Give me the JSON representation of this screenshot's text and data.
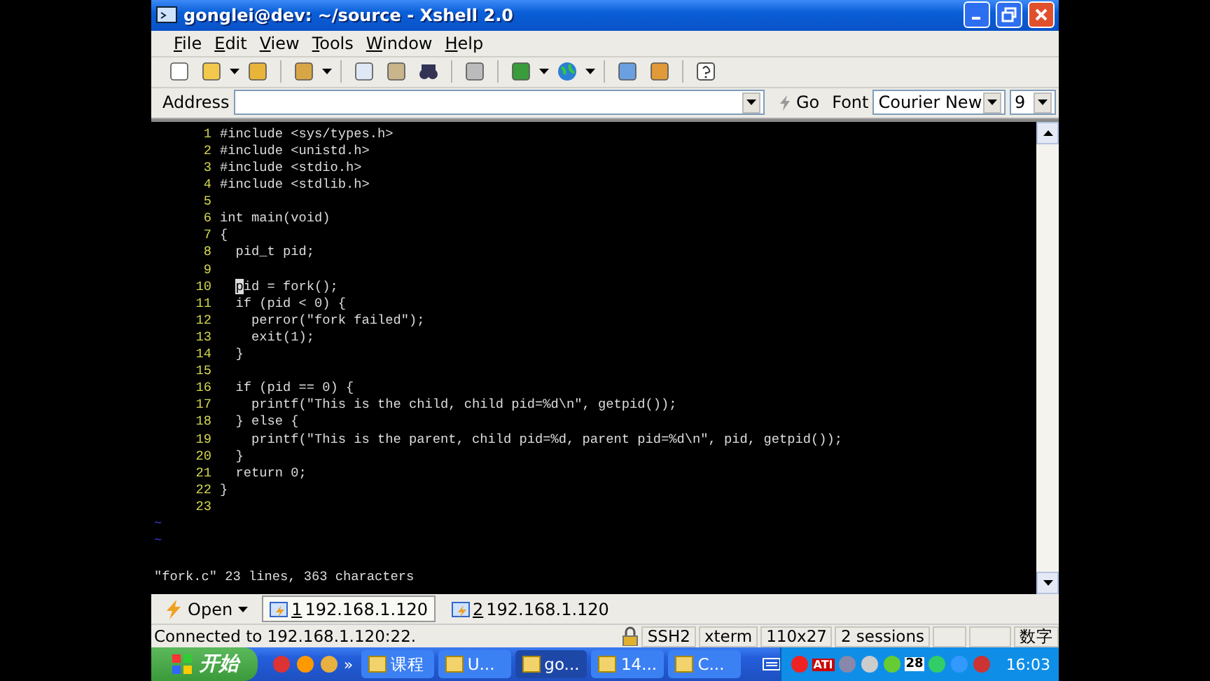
{
  "window": {
    "title": "gonglei@dev: ~/source - Xshell 2.0"
  },
  "menu": [
    "File",
    "Edit",
    "View",
    "Tools",
    "Window",
    "Help"
  ],
  "address_bar": {
    "label": "Address",
    "go_button": "Go",
    "font_label": "Font",
    "font": "Courier New",
    "font_size": "9"
  },
  "terminal": {
    "lines": [
      {
        "number": "1",
        "code": "#include <sys/types.h>"
      },
      {
        "number": "2",
        "code": "#include <unistd.h>"
      },
      {
        "number": "3",
        "code": "#include <stdio.h>"
      },
      {
        "number": "4",
        "code": "#include <stdlib.h>"
      },
      {
        "number": "5"
      },
      {
        "number": "6",
        "code": "int main(void)"
      },
      {
        "number": "7",
        "code": "{"
      },
      {
        "number": "8",
        "code": "  pid_t pid;"
      },
      {
        "number": "9"
      },
      {
        "number": "10",
        "indented": true,
        "cursor_char": "p",
        "code": "id = fork();"
      },
      {
        "number": "11",
        "code": "  if (pid < 0) {"
      },
      {
        "number": "12",
        "code": "    perror(\"fork failed\");"
      },
      {
        "number": "13",
        "code": "    exit(1);"
      },
      {
        "number": "14",
        "code": "  }"
      },
      {
        "number": "15"
      },
      {
        "number": "16",
        "code": "  if (pid == 0) {"
      },
      {
        "number": "17",
        "code": "    printf(\"This is the child, child pid=%d\\n\", getpid());"
      },
      {
        "number": "18",
        "code": "  } else {"
      },
      {
        "number": "19",
        "code": "    printf(\"This is the parent, child pid=%d, parent pid=%d\\n\", pid, getpid());"
      },
      {
        "number": "20",
        "code": "  }"
      },
      {
        "number": "21",
        "code": "  return 0;"
      },
      {
        "number": "22",
        "code": "}"
      },
      {
        "number": "23"
      }
    ],
    "empty_line_marks": [
      "~",
      "~"
    ],
    "message": "\"fork.c\" 23 lines, 363 characters"
  },
  "session_bar": {
    "open_button": "Open",
    "tabs": [
      {
        "number": "1",
        "host": "192.168.1.120",
        "selected": true
      },
      {
        "number": "2",
        "host": "192.168.1.120",
        "selected": false
      }
    ]
  },
  "status_bar": {
    "message": "Connected to 192.168.1.120:22.",
    "panes": [
      "SSH2",
      "xterm",
      "110x27",
      "2 sessions"
    ],
    "num_lock": "数字"
  },
  "taskbar": {
    "start": "开始",
    "more": "»",
    "tasks": [
      {
        "label": "课程",
        "selected": false
      },
      {
        "label": "U...",
        "selected": false
      },
      {
        "label": "go...",
        "selected": true
      },
      {
        "label": "14...",
        "selected": false
      },
      {
        "label": "C...",
        "selected": false
      }
    ],
    "tray_badge": "ATI",
    "calendar_day": "28",
    "clock": "16:03"
  }
}
